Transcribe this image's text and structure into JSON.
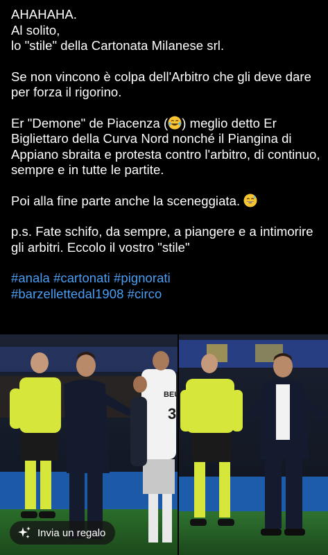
{
  "post": {
    "line1": "AHAHAHA.",
    "line2": "Al solito,",
    "line3": "lo \"stile\" della Cartonata Milanese srl.",
    "para2": "Se non vincono è colpa dell'Arbitro che gli deve dare per forza il rigorino.",
    "para3_a": "Er \"Demone\" de Piacenza (",
    "para3_emoji": "tears-of-joy-emoji",
    "para3_b": ") meglio detto Er Bigliettaro della Curva Nord nonché il Piangina di Appiano sbraita e protesta contro l'arbitro, di continuo, sempre e in tutte le partite.",
    "para4": "Poi alla fine parte anche la sceneggiata.",
    "para4_emoji": "grinning-sweat-emoji",
    "para5": "p.s. Fate schifo, da sempre, a piangere e a intimorire gli arbitri. Eccolo il vostro \"stile\"",
    "hashtags": [
      "#anala",
      "#cartonati",
      "#pignorati",
      "#barzellettedal1908",
      "#circo"
    ]
  },
  "photos": {
    "left_shirt_text": "BEU",
    "left_number": "3"
  },
  "gift_button": {
    "label": "Invia un regalo",
    "icon": "gift-sparkle-icon"
  },
  "colors": {
    "background": "#000000",
    "text": "#ffffff",
    "hashtag": "#4a9ff5",
    "referee_shirt": "#d7e63a"
  }
}
